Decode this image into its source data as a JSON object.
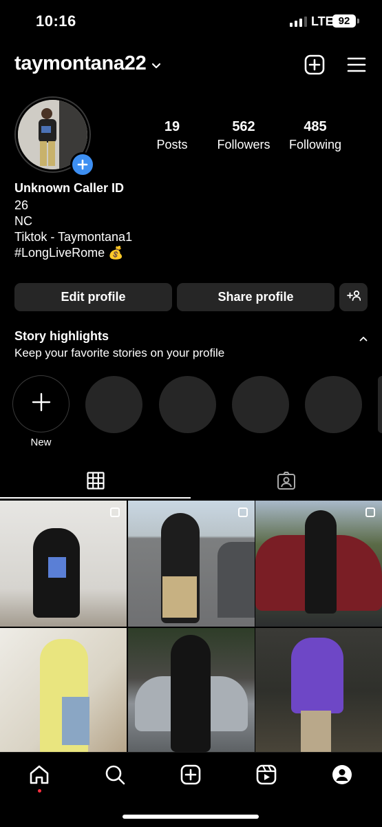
{
  "status_bar": {
    "time": "10:16",
    "network": "LTE",
    "battery": "92"
  },
  "header": {
    "username": "taymontana22",
    "icons": [
      "chevron-down-icon",
      "create-post-icon",
      "menu-icon"
    ]
  },
  "profile": {
    "stats": [
      {
        "value": "19",
        "label": "Posts"
      },
      {
        "value": "562",
        "label": "Followers"
      },
      {
        "value": "485",
        "label": "Following"
      }
    ],
    "bio": {
      "name": "Unknown Caller ID",
      "line1": "26",
      "line2": "NC",
      "line3": "Tiktok - Taymontana1",
      "line4": "#LongLiveRome 💰"
    }
  },
  "actions": {
    "edit": "Edit profile",
    "share": "Share profile",
    "discover_icon": "add-person-icon"
  },
  "highlights": {
    "title": "Story highlights",
    "subtitle": "Keep your favorite stories on your profile",
    "new_label": "New"
  },
  "tabs": [
    "grid-icon",
    "tagged-icon"
  ],
  "nav": [
    "home-icon",
    "search-icon",
    "create-icon",
    "reels-icon",
    "profile-icon"
  ],
  "colors": {
    "accent": "#3d8ff2",
    "button_bg": "#262626",
    "notification": "#ff3040"
  }
}
